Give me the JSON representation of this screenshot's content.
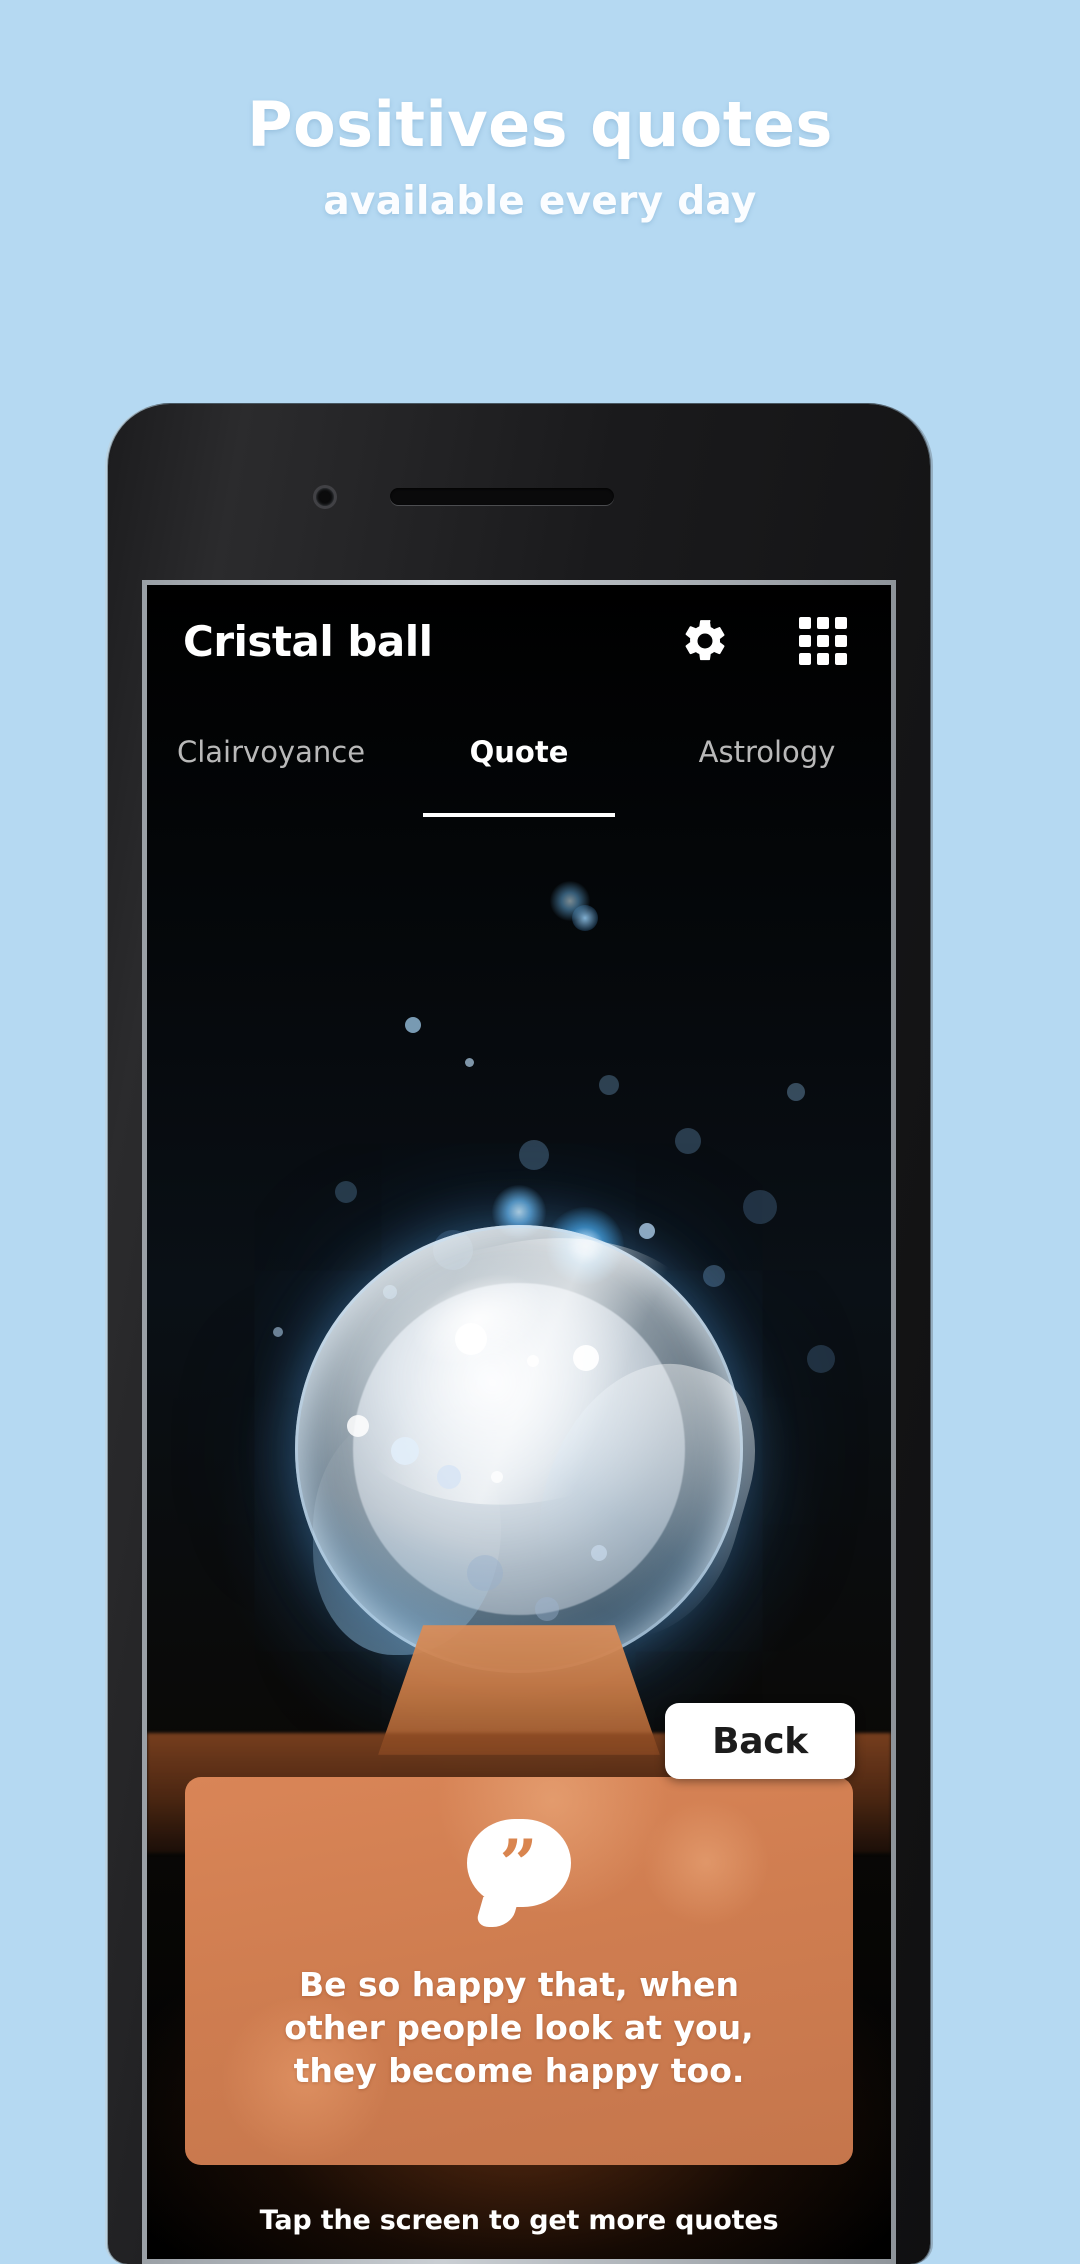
{
  "promo": {
    "title": "Positives quotes",
    "subtitle": "available every day",
    "background_color": "#b5d9f2",
    "text_color": "#ffffff"
  },
  "app": {
    "title": "Cristal ball",
    "appbar": {
      "settings_icon": "gear-icon",
      "apps_icon": "grid-icon"
    },
    "tabs": [
      {
        "label": "Clairvoyance",
        "active": false
      },
      {
        "label": "Quote",
        "active": true
      },
      {
        "label": "Astrology",
        "active": false
      }
    ],
    "back_button": {
      "label": "Back"
    },
    "quote_card": {
      "icon": "quote-bubble-icon",
      "marks": "”",
      "line1": "Be so happy that, when",
      "line2": "other people look at you,",
      "line3": "they become happy too.",
      "background_color": "#cf7d50",
      "text_color": "#ffffff"
    },
    "hint": "Tap the screen to get more quotes"
  }
}
